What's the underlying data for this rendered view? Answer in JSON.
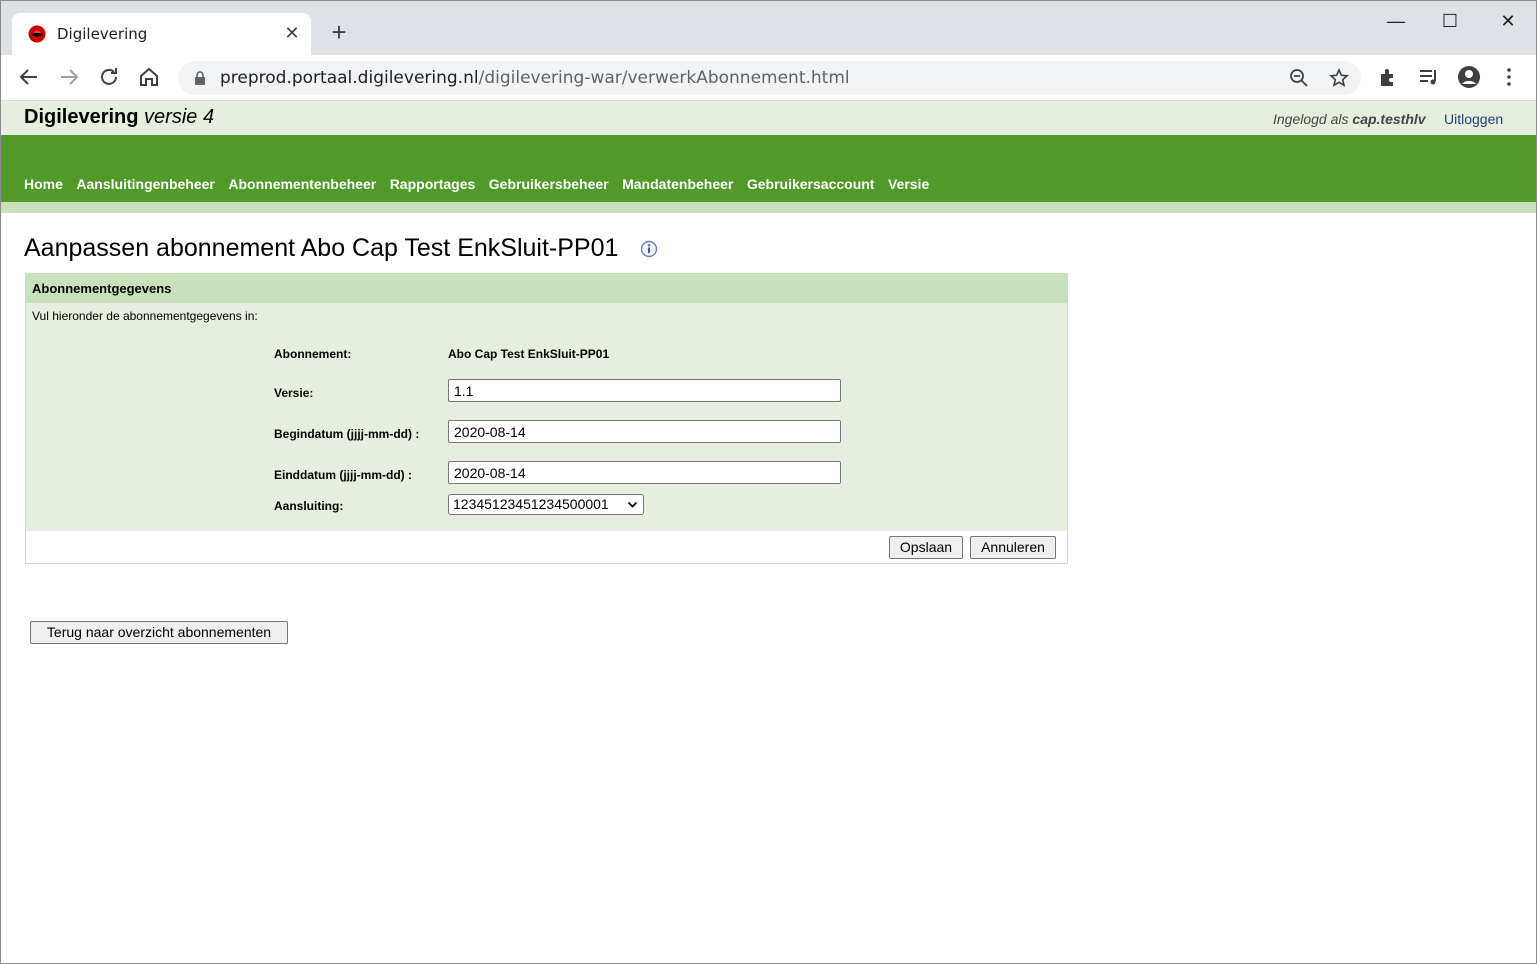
{
  "browser": {
    "tab_title": "Digilevering",
    "url_host": "preprod.portaal.digilevering.nl",
    "url_path": "/digilevering-war/verwerkAbonnement.html",
    "new_tab": "+",
    "minimize": "—",
    "maximize": "☐",
    "close_window": "✕",
    "close_tab": "✕"
  },
  "header": {
    "brand_name": "Digilevering",
    "brand_version": "versie 4",
    "logged_in_prefix": "Ingelogd als",
    "username": "cap.testhlv",
    "logout": "Uitloggen"
  },
  "nav": {
    "items": [
      "Home",
      "Aansluitingenbeheer",
      "Abonnementenbeheer",
      "Rapportages",
      "Gebruikersbeheer",
      "Mandatenbeheer",
      "Gebruikersaccount",
      "Versie"
    ]
  },
  "page": {
    "title": "Aanpassen abonnement Abo Cap Test EnkSluit-PP01"
  },
  "form": {
    "section_title": "Abonnementgegevens",
    "intro": "Vul hieronder de abonnementgegevens in:",
    "abonnement_label": "Abonnement:",
    "abonnement_value": "Abo Cap Test EnkSluit-PP01",
    "versie_label": "Versie:",
    "versie_value": "1.1",
    "begindatum_label": "Begindatum (jjjj-mm-dd) :",
    "begindatum_value": "2020-08-14",
    "einddatum_label": "Einddatum (jjjj-mm-dd) :",
    "einddatum_value": "2020-08-14",
    "aansluiting_label": "Aansluiting:",
    "aansluiting_value": "12345123451234500001",
    "save_button": "Opslaan",
    "cancel_button": "Annuleren"
  },
  "back_button": "Terug naar overzicht abonnementen",
  "colors": {
    "nav_green": "#519a29",
    "light_green": "#e6efdf",
    "mid_green": "#c9e0bd"
  }
}
